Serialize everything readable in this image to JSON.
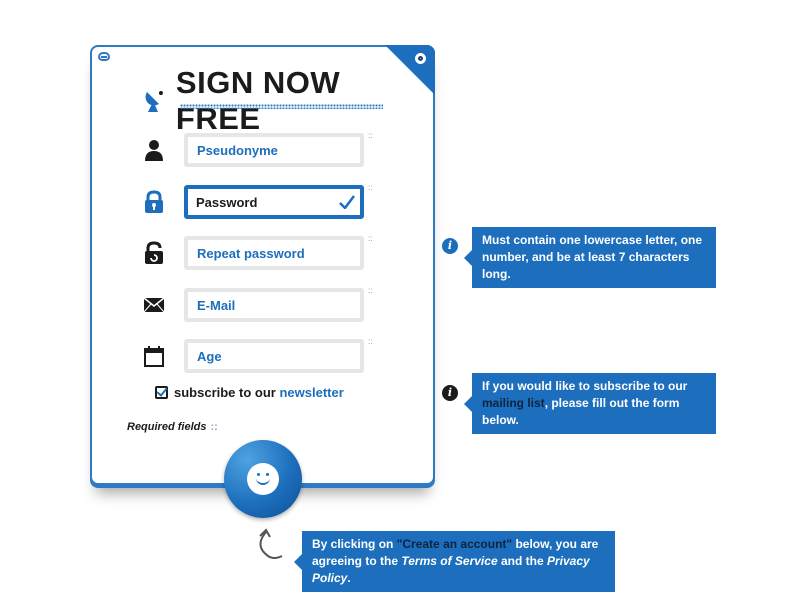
{
  "form": {
    "title": "SIGN NOW FREE",
    "fields": [
      {
        "icon": "user-icon",
        "placeholder": "Pseudonyme",
        "value": ""
      },
      {
        "icon": "lock-icon",
        "placeholder": "Password",
        "value": "Password",
        "valid": true
      },
      {
        "icon": "lock-refresh-icon",
        "placeholder": "Repeat password",
        "value": ""
      },
      {
        "icon": "envelope-icon",
        "placeholder": "E-Mail",
        "value": ""
      },
      {
        "icon": "calendar-icon",
        "placeholder": "Age",
        "value": ""
      }
    ],
    "required_mark": "::",
    "subscribe": {
      "prefix": "subscribe to our ",
      "link": "newsletter",
      "checked": true
    },
    "required_note": "Required fields",
    "required_note_mark": "::"
  },
  "tips": {
    "password": "Must contain one lowercase letter, one number, and be at least 7 characters long.",
    "mailing_prefix": "If you would like to subscribe to our ",
    "mailing_highlight": "mailing list",
    "mailing_suffix": ", please fill out the form below.",
    "terms_1": "By clicking on ",
    "terms_highlight": "\"Create an account\"",
    "terms_2": " below, you are agreeing to the ",
    "terms_tos": "Terms of Service",
    "terms_3": " and the ",
    "terms_privacy": "Privacy Policy",
    "terms_4": "."
  },
  "info_glyph": "i",
  "colors": {
    "accent": "#1d6fbd",
    "text": "#1b1b1b"
  }
}
